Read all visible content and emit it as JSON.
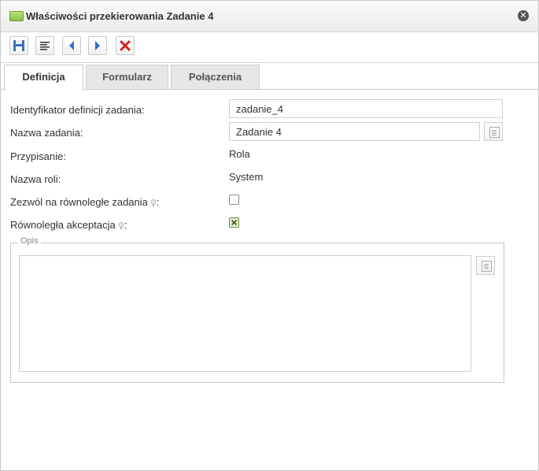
{
  "dialog": {
    "title": "Właściwości przekierowania Zadanie 4",
    "close_icon": "close-circle-icon"
  },
  "toolbar": {
    "buttons": [
      {
        "name": "save-icon"
      },
      {
        "name": "text-align-icon"
      },
      {
        "name": "previous-arrow-icon"
      },
      {
        "name": "next-arrow-icon"
      },
      {
        "name": "delete-icon"
      }
    ]
  },
  "tabs": [
    {
      "label": "Definicja",
      "active": true
    },
    {
      "label": "Formularz",
      "active": false
    },
    {
      "label": "Połączenia",
      "active": false
    }
  ],
  "form": {
    "task_def_id": {
      "label": "Identyfikator definicji zadania:",
      "value": "zadanie_4"
    },
    "task_name": {
      "label": "Nazwa zadania:",
      "value": "Zadanie 4"
    },
    "assignment": {
      "label": "Przypisanie:",
      "value": "Rola"
    },
    "role_name": {
      "label": "Nazwa roli:",
      "value": "System"
    },
    "allow_parallel": {
      "label": "Zezwól na równoległe zadania",
      "suffix": ":",
      "checked": false
    },
    "parallel_accept": {
      "label": "Równoległa akceptacja",
      "suffix": ":",
      "checked": true
    },
    "description": {
      "legend": "Opis",
      "value": ""
    }
  },
  "colors": {
    "accent_green": "#8cc24a",
    "arrow_blue": "#2f6fd1",
    "delete_red": "#d62020"
  }
}
